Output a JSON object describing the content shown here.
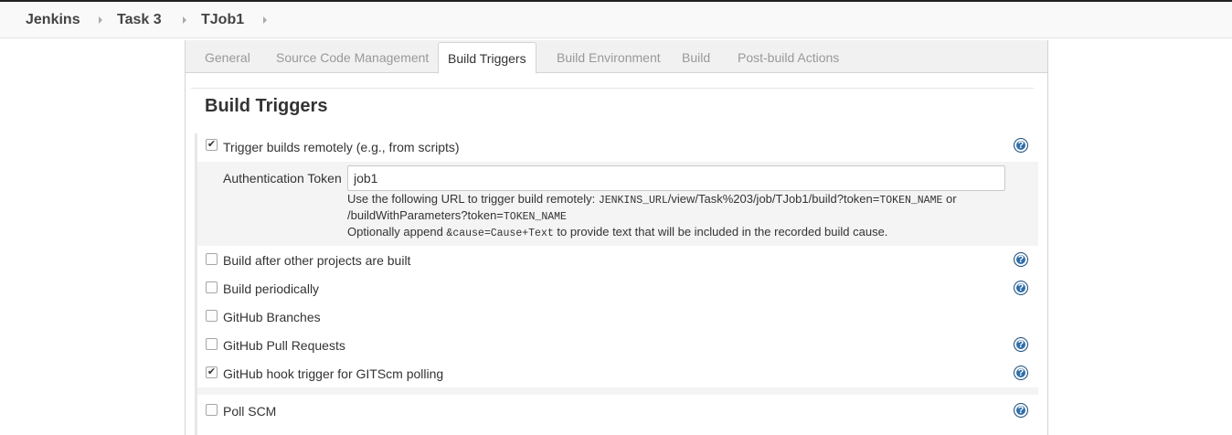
{
  "breadcrumbs": [
    "Jenkins",
    "Task 3",
    "TJob1"
  ],
  "tabs": [
    {
      "label": "General",
      "active": false
    },
    {
      "label": "Source Code Management",
      "active": false
    },
    {
      "label": "Build Triggers",
      "active": true
    },
    {
      "label": "Build Environment",
      "active": false
    },
    {
      "label": "Build",
      "active": false
    },
    {
      "label": "Post-build Actions",
      "active": false
    }
  ],
  "section": {
    "title": "Build Triggers"
  },
  "triggers": [
    {
      "label": "Trigger builds remotely (e.g., from scripts)",
      "checked": true,
      "help": true
    },
    {
      "label": "Build after other projects are built",
      "checked": false,
      "help": true
    },
    {
      "label": "Build periodically",
      "checked": false,
      "help": true
    },
    {
      "label": "GitHub Branches",
      "checked": false,
      "help": false
    },
    {
      "label": "GitHub Pull Requests",
      "checked": false,
      "help": true
    },
    {
      "label": "GitHub hook trigger for GITScm polling",
      "checked": true,
      "help": true
    },
    {
      "label": "Poll SCM",
      "checked": false,
      "help": true
    }
  ],
  "remote": {
    "auth_label": "Authentication Token",
    "auth_value": "job1",
    "desc_line1_a": "Use the following URL to trigger build remotely: ",
    "desc_line1_code1": "JENKINS_URL",
    "desc_line1_b": "/view/Task%203/job/TJob1/build?token=",
    "desc_line1_code2": "TOKEN_NAME",
    "desc_line1_c": " or",
    "desc_line2_a": "/buildWithParameters?token=",
    "desc_line2_code": "TOKEN_NAME",
    "desc_line3_a": "Optionally append ",
    "desc_line3_code": "&cause=Cause+Text",
    "desc_line3_b": " to provide text that will be included in the recorded build cause."
  },
  "icons": {
    "help": "question-mark-circle-icon",
    "check": "checkmark-icon"
  },
  "colors": {
    "help_blue": "#2f6ea8",
    "tab_bg": "#f1f1f1",
    "subblock_bg": "#f4f4f4"
  }
}
